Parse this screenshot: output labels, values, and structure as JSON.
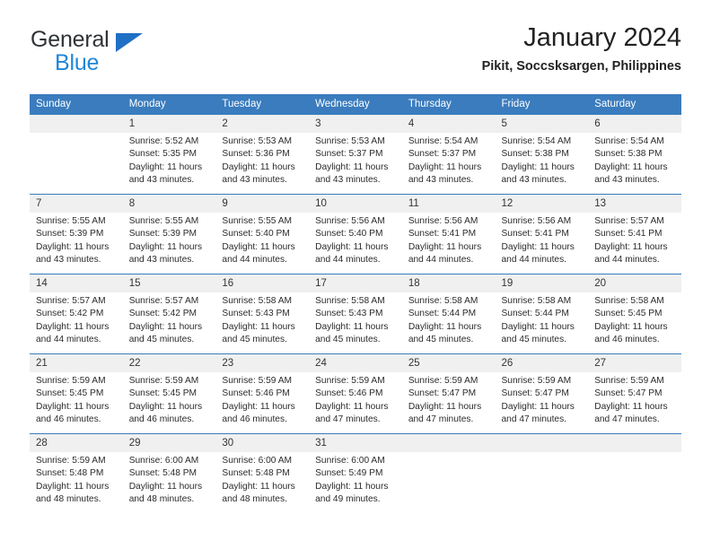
{
  "brand": {
    "name_top": "General",
    "name_bottom": "Blue",
    "triangle_color": "#1f6fc4",
    "blue_color": "#1f86d8"
  },
  "header": {
    "title": "January 2024",
    "location": "Pikit, Soccsksargen, Philippines"
  },
  "theme": {
    "header_bar_color": "#3a7cbe",
    "daynum_band_color": "#f0f0f0",
    "cell_background": "#ffffff",
    "text_color": "#2b2b2b"
  },
  "weekdays": [
    "Sunday",
    "Monday",
    "Tuesday",
    "Wednesday",
    "Thursday",
    "Friday",
    "Saturday"
  ],
  "weeks": [
    [
      {
        "day": "",
        "sunrise": "",
        "sunset": "",
        "daylight1": "",
        "daylight2": ""
      },
      {
        "day": "1",
        "sunrise": "Sunrise: 5:52 AM",
        "sunset": "Sunset: 5:35 PM",
        "daylight1": "Daylight: 11 hours",
        "daylight2": "and 43 minutes."
      },
      {
        "day": "2",
        "sunrise": "Sunrise: 5:53 AM",
        "sunset": "Sunset: 5:36 PM",
        "daylight1": "Daylight: 11 hours",
        "daylight2": "and 43 minutes."
      },
      {
        "day": "3",
        "sunrise": "Sunrise: 5:53 AM",
        "sunset": "Sunset: 5:37 PM",
        "daylight1": "Daylight: 11 hours",
        "daylight2": "and 43 minutes."
      },
      {
        "day": "4",
        "sunrise": "Sunrise: 5:54 AM",
        "sunset": "Sunset: 5:37 PM",
        "daylight1": "Daylight: 11 hours",
        "daylight2": "and 43 minutes."
      },
      {
        "day": "5",
        "sunrise": "Sunrise: 5:54 AM",
        "sunset": "Sunset: 5:38 PM",
        "daylight1": "Daylight: 11 hours",
        "daylight2": "and 43 minutes."
      },
      {
        "day": "6",
        "sunrise": "Sunrise: 5:54 AM",
        "sunset": "Sunset: 5:38 PM",
        "daylight1": "Daylight: 11 hours",
        "daylight2": "and 43 minutes."
      }
    ],
    [
      {
        "day": "7",
        "sunrise": "Sunrise: 5:55 AM",
        "sunset": "Sunset: 5:39 PM",
        "daylight1": "Daylight: 11 hours",
        "daylight2": "and 43 minutes."
      },
      {
        "day": "8",
        "sunrise": "Sunrise: 5:55 AM",
        "sunset": "Sunset: 5:39 PM",
        "daylight1": "Daylight: 11 hours",
        "daylight2": "and 43 minutes."
      },
      {
        "day": "9",
        "sunrise": "Sunrise: 5:55 AM",
        "sunset": "Sunset: 5:40 PM",
        "daylight1": "Daylight: 11 hours",
        "daylight2": "and 44 minutes."
      },
      {
        "day": "10",
        "sunrise": "Sunrise: 5:56 AM",
        "sunset": "Sunset: 5:40 PM",
        "daylight1": "Daylight: 11 hours",
        "daylight2": "and 44 minutes."
      },
      {
        "day": "11",
        "sunrise": "Sunrise: 5:56 AM",
        "sunset": "Sunset: 5:41 PM",
        "daylight1": "Daylight: 11 hours",
        "daylight2": "and 44 minutes."
      },
      {
        "day": "12",
        "sunrise": "Sunrise: 5:56 AM",
        "sunset": "Sunset: 5:41 PM",
        "daylight1": "Daylight: 11 hours",
        "daylight2": "and 44 minutes."
      },
      {
        "day": "13",
        "sunrise": "Sunrise: 5:57 AM",
        "sunset": "Sunset: 5:41 PM",
        "daylight1": "Daylight: 11 hours",
        "daylight2": "and 44 minutes."
      }
    ],
    [
      {
        "day": "14",
        "sunrise": "Sunrise: 5:57 AM",
        "sunset": "Sunset: 5:42 PM",
        "daylight1": "Daylight: 11 hours",
        "daylight2": "and 44 minutes."
      },
      {
        "day": "15",
        "sunrise": "Sunrise: 5:57 AM",
        "sunset": "Sunset: 5:42 PM",
        "daylight1": "Daylight: 11 hours",
        "daylight2": "and 45 minutes."
      },
      {
        "day": "16",
        "sunrise": "Sunrise: 5:58 AM",
        "sunset": "Sunset: 5:43 PM",
        "daylight1": "Daylight: 11 hours",
        "daylight2": "and 45 minutes."
      },
      {
        "day": "17",
        "sunrise": "Sunrise: 5:58 AM",
        "sunset": "Sunset: 5:43 PM",
        "daylight1": "Daylight: 11 hours",
        "daylight2": "and 45 minutes."
      },
      {
        "day": "18",
        "sunrise": "Sunrise: 5:58 AM",
        "sunset": "Sunset: 5:44 PM",
        "daylight1": "Daylight: 11 hours",
        "daylight2": "and 45 minutes."
      },
      {
        "day": "19",
        "sunrise": "Sunrise: 5:58 AM",
        "sunset": "Sunset: 5:44 PM",
        "daylight1": "Daylight: 11 hours",
        "daylight2": "and 45 minutes."
      },
      {
        "day": "20",
        "sunrise": "Sunrise: 5:58 AM",
        "sunset": "Sunset: 5:45 PM",
        "daylight1": "Daylight: 11 hours",
        "daylight2": "and 46 minutes."
      }
    ],
    [
      {
        "day": "21",
        "sunrise": "Sunrise: 5:59 AM",
        "sunset": "Sunset: 5:45 PM",
        "daylight1": "Daylight: 11 hours",
        "daylight2": "and 46 minutes."
      },
      {
        "day": "22",
        "sunrise": "Sunrise: 5:59 AM",
        "sunset": "Sunset: 5:45 PM",
        "daylight1": "Daylight: 11 hours",
        "daylight2": "and 46 minutes."
      },
      {
        "day": "23",
        "sunrise": "Sunrise: 5:59 AM",
        "sunset": "Sunset: 5:46 PM",
        "daylight1": "Daylight: 11 hours",
        "daylight2": "and 46 minutes."
      },
      {
        "day": "24",
        "sunrise": "Sunrise: 5:59 AM",
        "sunset": "Sunset: 5:46 PM",
        "daylight1": "Daylight: 11 hours",
        "daylight2": "and 47 minutes."
      },
      {
        "day": "25",
        "sunrise": "Sunrise: 5:59 AM",
        "sunset": "Sunset: 5:47 PM",
        "daylight1": "Daylight: 11 hours",
        "daylight2": "and 47 minutes."
      },
      {
        "day": "26",
        "sunrise": "Sunrise: 5:59 AM",
        "sunset": "Sunset: 5:47 PM",
        "daylight1": "Daylight: 11 hours",
        "daylight2": "and 47 minutes."
      },
      {
        "day": "27",
        "sunrise": "Sunrise: 5:59 AM",
        "sunset": "Sunset: 5:47 PM",
        "daylight1": "Daylight: 11 hours",
        "daylight2": "and 47 minutes."
      }
    ],
    [
      {
        "day": "28",
        "sunrise": "Sunrise: 5:59 AM",
        "sunset": "Sunset: 5:48 PM",
        "daylight1": "Daylight: 11 hours",
        "daylight2": "and 48 minutes."
      },
      {
        "day": "29",
        "sunrise": "Sunrise: 6:00 AM",
        "sunset": "Sunset: 5:48 PM",
        "daylight1": "Daylight: 11 hours",
        "daylight2": "and 48 minutes."
      },
      {
        "day": "30",
        "sunrise": "Sunrise: 6:00 AM",
        "sunset": "Sunset: 5:48 PM",
        "daylight1": "Daylight: 11 hours",
        "daylight2": "and 48 minutes."
      },
      {
        "day": "31",
        "sunrise": "Sunrise: 6:00 AM",
        "sunset": "Sunset: 5:49 PM",
        "daylight1": "Daylight: 11 hours",
        "daylight2": "and 49 minutes."
      },
      {
        "day": "",
        "sunrise": "",
        "sunset": "",
        "daylight1": "",
        "daylight2": ""
      },
      {
        "day": "",
        "sunrise": "",
        "sunset": "",
        "daylight1": "",
        "daylight2": ""
      },
      {
        "day": "",
        "sunrise": "",
        "sunset": "",
        "daylight1": "",
        "daylight2": ""
      }
    ]
  ]
}
